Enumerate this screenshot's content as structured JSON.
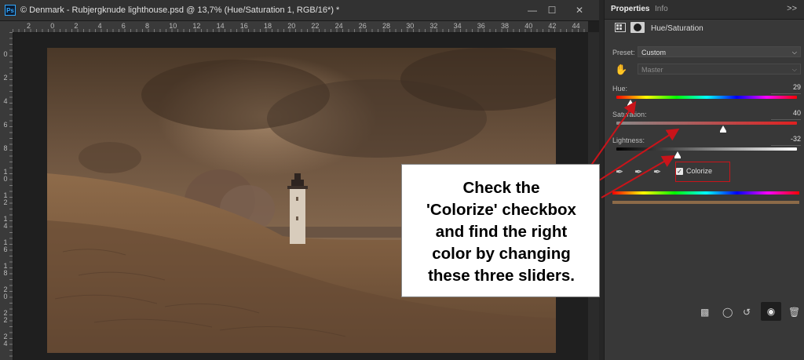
{
  "document": {
    "app_logo": "Ps",
    "title": "© Denmark - Rubjergknude lighthouse.psd @ 13,7% (Hue/Saturation 1, RGB/16*) *",
    "window_controls": [
      "—",
      "☐",
      "✕"
    ],
    "ruler_h_labels": [
      "2",
      "0",
      "2",
      "4",
      "6",
      "8",
      "10",
      "12",
      "14",
      "16",
      "18",
      "20",
      "22",
      "24",
      "26",
      "28",
      "30",
      "32",
      "34",
      "36",
      "38",
      "40",
      "42",
      "44"
    ],
    "ruler_v_labels": [
      "0",
      "2",
      "4",
      "6",
      "8",
      "1\n0",
      "1\n2",
      "1\n4",
      "1\n6",
      "1\n8",
      "2\n0",
      "2\n2",
      "2\n4"
    ]
  },
  "panel": {
    "tabs": [
      "Properties",
      "Info"
    ],
    "collapse_icon": ">>",
    "adjustment_title": "Hue/Saturation",
    "preset_label": "Preset:",
    "preset_value": "Custom",
    "channel_value": "Master",
    "hue": {
      "label": "Hue:",
      "value": "29",
      "position": 0.08
    },
    "saturation": {
      "label": "Saturation:",
      "value": "40",
      "position": 0.59
    },
    "lightness": {
      "label": "Lightness:",
      "value": "-32",
      "position": 0.34
    },
    "colorize_label": "Colorize",
    "colorize_checked": true
  },
  "callout": {
    "lines": [
      "Check the",
      "'Colorize' checkbox",
      "and find the right",
      "color by changing",
      "these three sliders."
    ]
  },
  "colors": {
    "accent": "#c9141a",
    "tint": "#8c6a48"
  }
}
